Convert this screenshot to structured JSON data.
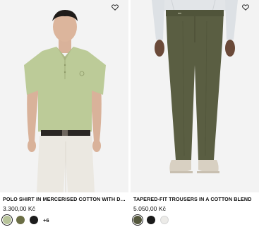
{
  "products": [
    {
      "title": "POLO SHIRT IN MERCERISED COTTON WITH DOUBLE B ...",
      "price": "3.300,00 Kč",
      "more_colors": "+6",
      "swatches": [
        {
          "name": "pale-green",
          "color": "#b8c49a",
          "selected": true
        },
        {
          "name": "olive",
          "color": "#6b6e45",
          "selected": false
        },
        {
          "name": "black",
          "color": "#1c1c1c",
          "selected": false
        }
      ]
    },
    {
      "title": "TAPERED-FIT TROUSERS IN A COTTON BLEND",
      "price": "5.050,00 Kč",
      "swatches": [
        {
          "name": "dark-olive",
          "color": "#55583e",
          "selected": true
        },
        {
          "name": "black",
          "color": "#1a1a1a",
          "selected": false
        },
        {
          "name": "off-white",
          "color": "#ecebe8",
          "selected": false
        }
      ]
    }
  ]
}
